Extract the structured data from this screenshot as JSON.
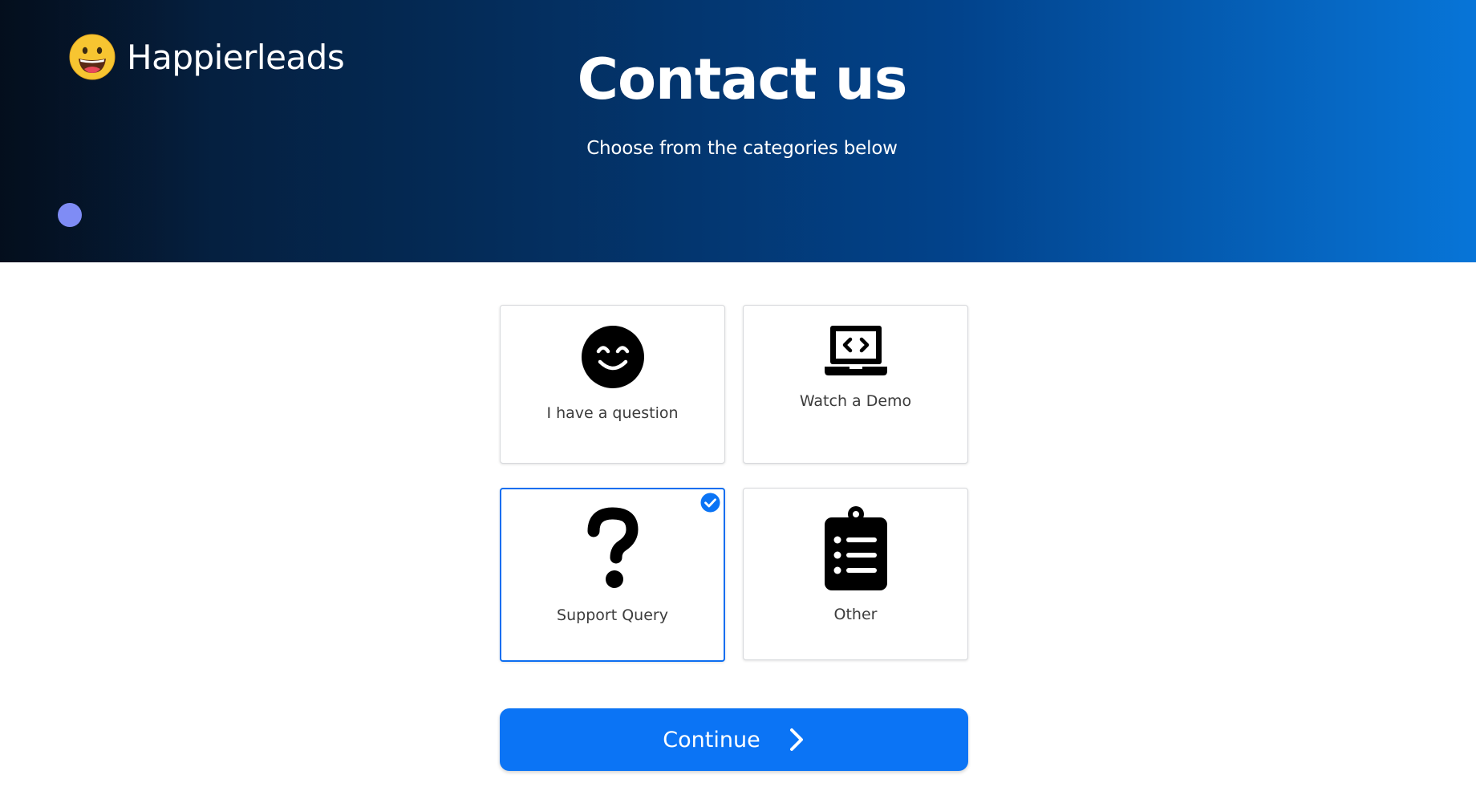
{
  "header": {
    "logo_text": "Happierleads",
    "logo_icon": "grinning-face-emoji",
    "title": "Contact us",
    "subtitle": "Choose from the categories below"
  },
  "options": [
    {
      "label": "I have a question",
      "icon": "smiling-face-icon",
      "selected": false
    },
    {
      "label": "Watch a Demo",
      "icon": "laptop-code-icon",
      "selected": false
    },
    {
      "label": "Support Query",
      "icon": "question-mark-icon",
      "selected": true
    },
    {
      "label": "Other",
      "icon": "clipboard-list-icon",
      "selected": false
    }
  ],
  "continue_button": {
    "label": "Continue",
    "icon": "chevron-right-icon"
  },
  "colors": {
    "accent": "#0b74f5",
    "selected_border": "#0d6ef0",
    "hero_dark": "#06162c",
    "hero_light": "#0775d8",
    "dot": "#7f8cf5"
  }
}
